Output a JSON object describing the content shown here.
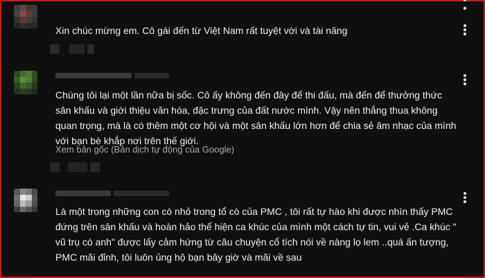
{
  "comments": [
    {
      "text": "Xin chúc mừng em. Cô gái đến từ Việt Nam rất tuyệt vời và tài năng",
      "menu_icon": "more-vertical-icon"
    },
    {
      "text": "Chúng tôi lại một lần nữa bị sốc. Cô ấy không đến đây để thi đấu, mà đến để thưởng thức sân khấu và giới thiệu văn hóa, đặc trưng của đất nước mình. Vậy nên thắng thua không quan trọng, mà là có thêm một cơ hội và một sân khấu lớn hơn để chia sẻ âm nhạc của mình với bạn bè khắp nơi trên thế giới.",
      "translate_link": "Xem bản gốc (Bản dịch tự động của Google)",
      "menu_icon": "more-vertical-icon"
    },
    {
      "text": "Là một trong những con cò nhỏ trong tổ cò của PMC , tôi rất tự hào khi được nhìn thấy PMC đứng trên sân khấu và hoàn hảo thể hiện ca khúc của mình một cách tự tin, vui vẻ .Ca khúc \" vũ trụ có anh\" được lấy cảm hứng từ câu chuyện cổ tích nói về nàng lọ lem ..quá ấn tượng, PMC mãi đỉnh, tôi luôn ủng hộ bạn bây giờ và mãi về sau",
      "menu_icon": "more-vertical-icon"
    }
  ],
  "colors": {
    "background": "#0f0f0f",
    "text": "#f1f1f1",
    "secondary_text": "#aaaaaa",
    "frame_border": "#d01818"
  }
}
